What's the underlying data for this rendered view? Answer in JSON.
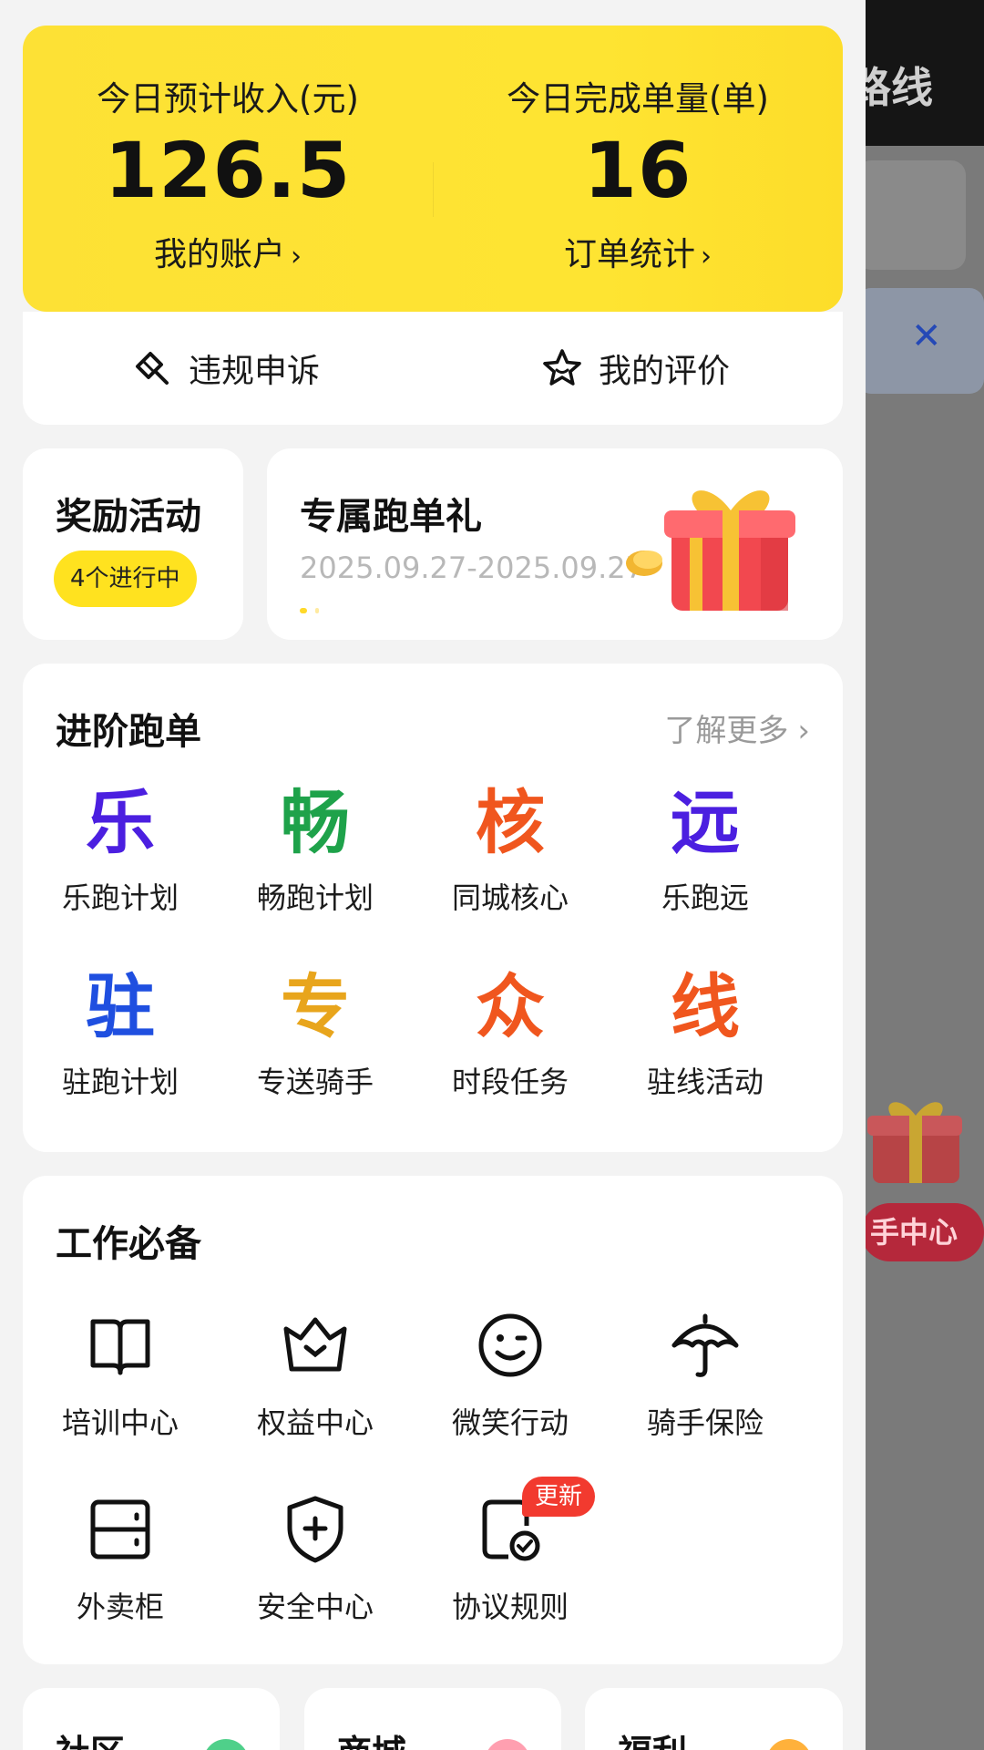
{
  "background": {
    "title": "路线",
    "close_symbol": "✕",
    "center_pill": "手中心"
  },
  "stats": {
    "income": {
      "label": "今日预计收入(元)",
      "value": "126.5",
      "link": "我的账户"
    },
    "orders": {
      "label": "今日完成单量(单)",
      "value": "16",
      "link": "订单统计"
    },
    "chevron": "›"
  },
  "quick": {
    "appeal": "违规申诉",
    "review": "我的评价"
  },
  "reward": {
    "title": "奖励活动",
    "badge": "4个进行中"
  },
  "exclusive": {
    "title": "专属跑单礼",
    "date": "2025.09.27-2025.09.27"
  },
  "advanced": {
    "title": "进阶跑单",
    "more": "了解更多",
    "more_chevron": "›",
    "items": [
      {
        "glyph": "乐",
        "label": "乐跑计划",
        "color": "#4b1fe0"
      },
      {
        "glyph": "畅",
        "label": "畅跑计划",
        "color": "#1ea24a"
      },
      {
        "glyph": "核",
        "label": "同城核心",
        "color": "#f0561e"
      },
      {
        "glyph": "远",
        "label": "乐跑远",
        "color": "#4b1fe0"
      },
      {
        "glyph": "驻",
        "label": "驻跑计划",
        "color": "#1f4fe0"
      },
      {
        "glyph": "专",
        "label": "专送骑手",
        "color": "#e8a51c"
      },
      {
        "glyph": "众",
        "label": "时段任务",
        "color": "#f0561e"
      },
      {
        "glyph": "线",
        "label": "驻线活动",
        "color": "#f0561e"
      }
    ]
  },
  "work": {
    "title": "工作必备",
    "items": [
      {
        "label": "培训中心",
        "icon": "book-icon"
      },
      {
        "label": "权益中心",
        "icon": "crown-icon"
      },
      {
        "label": "微笑行动",
        "icon": "smile-icon"
      },
      {
        "label": "骑手保险",
        "icon": "umbrella-icon"
      },
      {
        "label": "外卖柜",
        "icon": "locker-icon"
      },
      {
        "label": "安全中心",
        "icon": "shield-plus-icon"
      },
      {
        "label": "协议规则",
        "icon": "document-check-icon",
        "badge": "更新"
      }
    ]
  },
  "bottom": {
    "community": "社区",
    "mall": "商城",
    "welfare": "福利"
  }
}
